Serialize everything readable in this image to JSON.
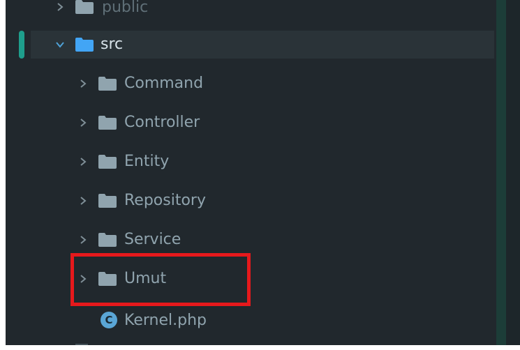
{
  "project_tree": {
    "items": [
      {
        "label": "public",
        "expanded": false,
        "type": "folder",
        "depth": 1
      },
      {
        "label": "src",
        "expanded": true,
        "type": "folder",
        "depth": 1,
        "selected": true
      },
      {
        "label": "Command",
        "expanded": false,
        "type": "folder",
        "depth": 2
      },
      {
        "label": "Controller",
        "expanded": false,
        "type": "folder",
        "depth": 2
      },
      {
        "label": "Entity",
        "expanded": false,
        "type": "folder",
        "depth": 2
      },
      {
        "label": "Repository",
        "expanded": false,
        "type": "folder",
        "depth": 2
      },
      {
        "label": "Service",
        "expanded": false,
        "type": "folder",
        "depth": 2
      },
      {
        "label": "Umut",
        "expanded": false,
        "type": "folder",
        "depth": 2,
        "highlighted": true
      },
      {
        "label": "Kernel.php",
        "type": "php-class-file",
        "depth": 2,
        "icon_letter": "C"
      }
    ]
  },
  "colors": {
    "background": "#21282d",
    "selected_row": "#2a3338",
    "folder_default": "#90a4ae",
    "folder_src": "#42a5f5",
    "label_text": "#90a4ae",
    "accent_marker": "#1e9e8c",
    "highlight_box": "#e6191c",
    "php_class_icon": "#5aa6d6"
  }
}
